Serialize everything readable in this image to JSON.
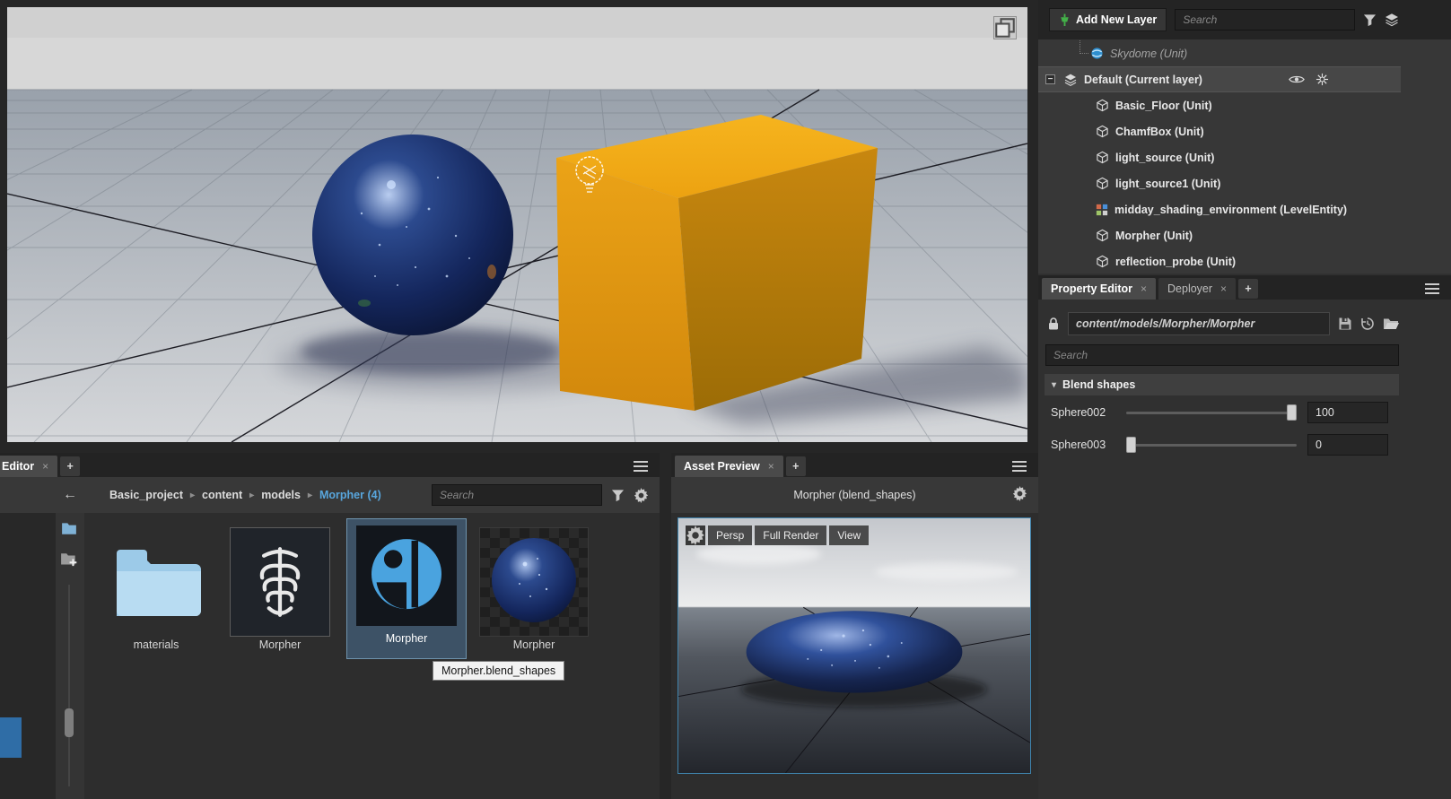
{
  "glyphs": {
    "chevron": "▸",
    "caret": "▾",
    "close": "×",
    "back": "←",
    "plus": "+",
    "collapse": "−"
  },
  "colors": {
    "accent_blue": "#58a6dd",
    "selection_blue": "#3d5266",
    "layer_green": "#43b049",
    "preview_border": "#3f83ac"
  },
  "outliner": {
    "add_layer": "Add New Layer",
    "search_placeholder": "Search",
    "items": [
      {
        "label": "Skydome (Unit)"
      },
      {
        "label": "Default (Current layer)"
      },
      {
        "label": "Basic_Floor (Unit)"
      },
      {
        "label": "ChamfBox (Unit)"
      },
      {
        "label": "light_source (Unit)"
      },
      {
        "label": "light_source1 (Unit)"
      },
      {
        "label": "midday_shading_environment (LevelEntity)"
      },
      {
        "label": "Morpher (Unit)"
      },
      {
        "label": "reflection_probe (Unit)"
      }
    ]
  },
  "property_editor": {
    "tabs": [
      {
        "label": "Property Editor"
      },
      {
        "label": "Deployer"
      }
    ],
    "asset_path": "content/models/Morpher/Morpher",
    "search_placeholder": "Search",
    "section": "Blend shapes",
    "sliders": [
      {
        "label": "Sphere002",
        "value": "100"
      },
      {
        "label": "Sphere003",
        "value": "0"
      }
    ]
  },
  "asset_browser": {
    "tab": "Editor",
    "breadcrumb": [
      "Basic_project",
      "content",
      "models",
      "Morpher (4)"
    ],
    "search_placeholder": "Search",
    "tiles": [
      {
        "label": "materials"
      },
      {
        "label": "Morpher"
      },
      {
        "label": "Morpher"
      },
      {
        "label": "Morpher"
      }
    ],
    "tooltip": "Morpher.blend_shapes"
  },
  "asset_preview": {
    "tab": "Asset Preview",
    "title": "Morpher (blend_shapes)",
    "toolbar": [
      "Persp",
      "Full Render",
      "View"
    ]
  }
}
